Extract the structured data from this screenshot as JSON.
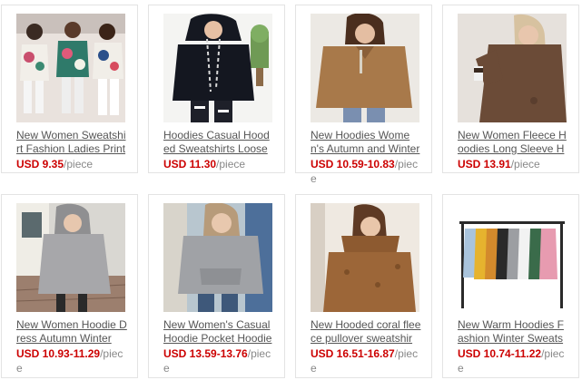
{
  "products": [
    {
      "title": "New Women Sweatshirt Fashion Ladies Print",
      "price": "USD 9.35",
      "unit": "/piece",
      "theme": "floral-tees"
    },
    {
      "title": "Hoodies Casual Hooded Sweatshirts Loose T",
      "price": "USD 11.30",
      "unit": "/piece",
      "theme": "black-hoodie"
    },
    {
      "title": "New Hoodies Women's Autumn and Winter",
      "price": "USD 10.59-10.83",
      "unit": "/piece",
      "theme": "tan-fleece"
    },
    {
      "title": "New Women Fleece Hoodies Long Sleeve H",
      "price": "USD 13.91",
      "unit": "/piece",
      "theme": "brown-fleece"
    },
    {
      "title": "New Women Hoodie Dress Autumn Winter",
      "price": "USD 10.93-11.29",
      "unit": "/piece",
      "theme": "grey-hoodie-dress"
    },
    {
      "title": "New Women's Casual Hoodie Pocket Hoodie",
      "price": "USD 13.59-13.76",
      "unit": "/piece",
      "theme": "grey-hoodie-jeans"
    },
    {
      "title": "New Hooded coral fleece pullover sweatshir",
      "price": "USD 16.51-16.87",
      "unit": "/piece",
      "theme": "camel-coral-fleece"
    },
    {
      "title": "New Warm Hoodies Fashion Winter Sweatsh",
      "price": "USD 10.74-11.22",
      "unit": "/piece",
      "theme": "color-rack"
    }
  ]
}
